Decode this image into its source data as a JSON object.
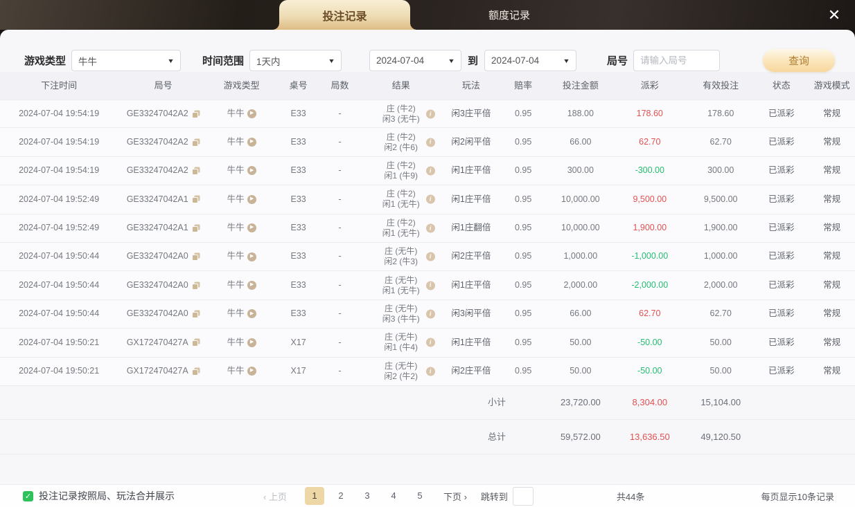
{
  "icons": {
    "close": "✕",
    "dropdown": "▼",
    "play": "▶",
    "info": "i",
    "check": "✓"
  },
  "colors": {
    "tab_gold": "#ddbc84",
    "button_gold": "#f8d79d",
    "win_red": "#e15151",
    "loss_green": "#23bd6f",
    "check_green": "#2fc25b",
    "page_active": "#eed7a6"
  },
  "topbar": {
    "tabs": [
      {
        "label": "投注记录",
        "active": true
      },
      {
        "label": "额度记录",
        "active": false
      }
    ]
  },
  "filters": {
    "game_type_label": "游戏类型",
    "game_type_value": "牛牛",
    "time_range_label": "时间范围",
    "time_range_value": "1天内",
    "date_from": "2024-07-04",
    "to_label": "到",
    "date_to": "2024-07-04",
    "round_label": "局号",
    "round_placeholder": "请输入局号",
    "round_value": "",
    "search_button": "查询"
  },
  "table": {
    "headers": [
      "下注时间",
      "局号",
      "游戏类型",
      "桌号",
      "局数",
      "结果",
      "玩法",
      "赔率",
      "投注金额",
      "派彩",
      "有效投注",
      "状态",
      "游戏模式"
    ],
    "rows": [
      {
        "time": "2024-07-04 19:54:19",
        "round_id": "GE33247042A2",
        "game": "牛牛",
        "table_no": "E33",
        "rounds": "-",
        "result_line1": "庄 (牛2)",
        "result_line2": "闲3 (无牛)",
        "play": "闲3庄平倍",
        "odds": "0.95",
        "bet": "188.00",
        "payout": "178.60",
        "payout_win": true,
        "valid": "178.60",
        "status": "已派彩",
        "mode": "常规"
      },
      {
        "time": "2024-07-04 19:54:19",
        "round_id": "GE33247042A2",
        "game": "牛牛",
        "table_no": "E33",
        "rounds": "-",
        "result_line1": "庄 (牛2)",
        "result_line2": "闲2 (牛6)",
        "play": "闲2闲平倍",
        "odds": "0.95",
        "bet": "66.00",
        "payout": "62.70",
        "payout_win": true,
        "valid": "62.70",
        "status": "已派彩",
        "mode": "常规"
      },
      {
        "time": "2024-07-04 19:54:19",
        "round_id": "GE33247042A2",
        "game": "牛牛",
        "table_no": "E33",
        "rounds": "-",
        "result_line1": "庄 (牛2)",
        "result_line2": "闲1 (牛9)",
        "play": "闲1庄平倍",
        "odds": "0.95",
        "bet": "300.00",
        "payout": "-300.00",
        "payout_win": false,
        "valid": "300.00",
        "status": "已派彩",
        "mode": "常规"
      },
      {
        "time": "2024-07-04 19:52:49",
        "round_id": "GE33247042A1",
        "game": "牛牛",
        "table_no": "E33",
        "rounds": "-",
        "result_line1": "庄 (牛2)",
        "result_line2": "闲1 (无牛)",
        "play": "闲1庄平倍",
        "odds": "0.95",
        "bet": "10,000.00",
        "payout": "9,500.00",
        "payout_win": true,
        "valid": "9,500.00",
        "status": "已派彩",
        "mode": "常规"
      },
      {
        "time": "2024-07-04 19:52:49",
        "round_id": "GE33247042A1",
        "game": "牛牛",
        "table_no": "E33",
        "rounds": "-",
        "result_line1": "庄 (牛2)",
        "result_line2": "闲1 (无牛)",
        "play": "闲1庄翻倍",
        "odds": "0.95",
        "bet": "10,000.00",
        "payout": "1,900.00",
        "payout_win": true,
        "valid": "1,900.00",
        "status": "已派彩",
        "mode": "常规"
      },
      {
        "time": "2024-07-04 19:50:44",
        "round_id": "GE33247042A0",
        "game": "牛牛",
        "table_no": "E33",
        "rounds": "-",
        "result_line1": "庄 (无牛)",
        "result_line2": "闲2 (牛3)",
        "play": "闲2庄平倍",
        "odds": "0.95",
        "bet": "1,000.00",
        "payout": "-1,000.00",
        "payout_win": false,
        "valid": "1,000.00",
        "status": "已派彩",
        "mode": "常规"
      },
      {
        "time": "2024-07-04 19:50:44",
        "round_id": "GE33247042A0",
        "game": "牛牛",
        "table_no": "E33",
        "rounds": "-",
        "result_line1": "庄 (无牛)",
        "result_line2": "闲1 (无牛)",
        "play": "闲1庄平倍",
        "odds": "0.95",
        "bet": "2,000.00",
        "payout": "-2,000.00",
        "payout_win": false,
        "valid": "2,000.00",
        "status": "已派彩",
        "mode": "常规"
      },
      {
        "time": "2024-07-04 19:50:44",
        "round_id": "GE33247042A0",
        "game": "牛牛",
        "table_no": "E33",
        "rounds": "-",
        "result_line1": "庄 (无牛)",
        "result_line2": "闲3 (牛牛)",
        "play": "闲3闲平倍",
        "odds": "0.95",
        "bet": "66.00",
        "payout": "62.70",
        "payout_win": true,
        "valid": "62.70",
        "status": "已派彩",
        "mode": "常规"
      },
      {
        "time": "2024-07-04 19:50:21",
        "round_id": "GX172470427A",
        "game": "牛牛",
        "table_no": "X17",
        "rounds": "-",
        "result_line1": "庄 (无牛)",
        "result_line2": "闲1 (牛4)",
        "play": "闲1庄平倍",
        "odds": "0.95",
        "bet": "50.00",
        "payout": "-50.00",
        "payout_win": false,
        "valid": "50.00",
        "status": "已派彩",
        "mode": "常规"
      },
      {
        "time": "2024-07-04 19:50:21",
        "round_id": "GX172470427A",
        "game": "牛牛",
        "table_no": "X17",
        "rounds": "-",
        "result_line1": "庄 (无牛)",
        "result_line2": "闲2 (牛2)",
        "play": "闲2庄平倍",
        "odds": "0.95",
        "bet": "50.00",
        "payout": "-50.00",
        "payout_win": false,
        "valid": "50.00",
        "status": "已派彩",
        "mode": "常规"
      }
    ],
    "subtotal": {
      "label": "小计",
      "bet": "23,720.00",
      "payout": "8,304.00",
      "valid": "15,104.00"
    },
    "total": {
      "label": "总计",
      "bet": "59,572.00",
      "payout": "13,636.50",
      "valid": "49,120.50"
    }
  },
  "footer": {
    "merge_label": "投注记录按照局、玩法合并展示",
    "merge_checked": true,
    "prev_label": "‹ 上页",
    "pages": [
      "1",
      "2",
      "3",
      "4",
      "5"
    ],
    "active_page": "1",
    "next_label": "下页 ›",
    "jump_label": "跳转到",
    "jump_value": "",
    "total_count": "共44条",
    "page_size": "每页显示10条记录"
  }
}
